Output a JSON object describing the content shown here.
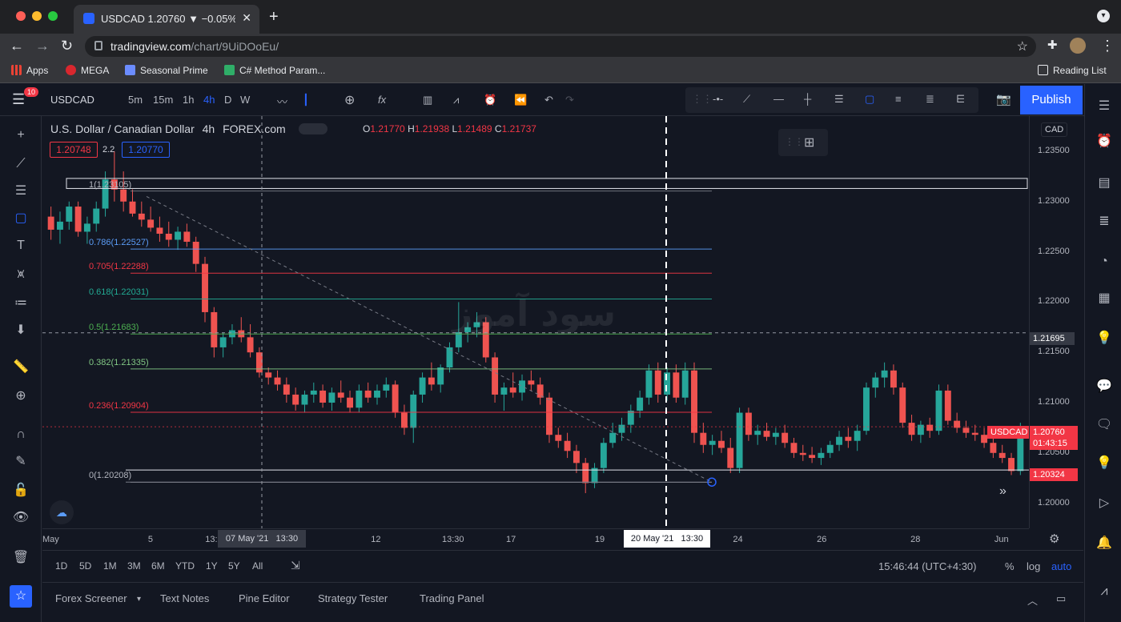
{
  "browser": {
    "tab_title": "USDCAD 1.20760 ▼ −0.05% pi",
    "url_host": "tradingview.com",
    "url_path": "/chart/9UiDOoEu/",
    "bookmarks": [
      "Apps",
      "MEGA",
      "Seasonal Prime",
      "C# Method Param..."
    ],
    "reading_list": "Reading List"
  },
  "toolbar": {
    "symbol": "USDCAD",
    "intervals": [
      "5m",
      "15m",
      "1h",
      "4h",
      "D",
      "W"
    ],
    "active_interval": "4h",
    "publish_label": "Publish",
    "notification_count": "10"
  },
  "legend": {
    "title": "U.S. Dollar / Canadian Dollar",
    "interval": "4h",
    "exchange": "FOREX.com",
    "o_label": "O",
    "o": "1.21770",
    "h_label": "H",
    "h": "1.21938",
    "l_label": "L",
    "l": "1.21489",
    "c_label": "C",
    "c": "1.21737",
    "bid": "1.20748",
    "spread": "2.2",
    "ask": "1.20770"
  },
  "watermark": "سود آموز",
  "fib_levels": [
    {
      "label": "1(1.23105)",
      "price": 1.23105,
      "color": "#787b86"
    },
    {
      "label": "0.786(1.22527)",
      "price": 1.22527,
      "color": "#5b9cf6"
    },
    {
      "label": "0.705(1.22288)",
      "price": 1.22288,
      "color": "#f23645"
    },
    {
      "label": "0.618(1.22031)",
      "price": 1.22031,
      "color": "#22ab94"
    },
    {
      "label": "0.5(1.21683)",
      "price": 1.21683,
      "color": "#4caf50"
    },
    {
      "label": "0.382(1.21335)",
      "price": 1.21335,
      "color": "#81c784"
    },
    {
      "label": "0.236(1.20904)",
      "price": 1.20904,
      "color": "#f23645"
    },
    {
      "label": "0(1.20208)",
      "price": 1.20208,
      "color": "#787b86"
    }
  ],
  "price_axis": {
    "currency": "CAD",
    "ticks": [
      "1.23500",
      "1.23000",
      "1.22500",
      "1.22000",
      "1.21500",
      "1.21000",
      "1.20500",
      "1.20000"
    ],
    "tick_values": [
      1.235,
      1.23,
      1.225,
      1.22,
      1.215,
      1.21,
      1.205,
      1.2
    ],
    "crosshair_price": "1.21695",
    "last_symbol": "USDCAD",
    "last_price": "1.20760",
    "countdown": "01:43:15",
    "low_tag": "1.20324"
  },
  "time_axis": {
    "ticks": [
      {
        "label": "May",
        "x": 0.0
      },
      {
        "label": "5",
        "x": 0.107
      },
      {
        "label": "13:",
        "x": 0.165
      },
      {
        "label": "12",
        "x": 0.333
      },
      {
        "label": "13:30",
        "x": 0.405
      },
      {
        "label": "17",
        "x": 0.47
      },
      {
        "label": "19",
        "x": 0.56
      },
      {
        "label": "24",
        "x": 0.7
      },
      {
        "label": "26",
        "x": 0.785
      },
      {
        "label": "28",
        "x": 0.88
      },
      {
        "label": "Jun",
        "x": 0.965
      }
    ],
    "crosshair_date": "07 May '21   13:30",
    "marker_date": "20 May '21   13:30"
  },
  "ranges": [
    "1D",
    "5D",
    "1M",
    "3M",
    "6M",
    "YTD",
    "1Y",
    "5Y",
    "All"
  ],
  "clock": "15:46:44 (UTC+4:30)",
  "axis_modes": [
    "%",
    "log",
    "auto"
  ],
  "bottom_tabs": [
    "Forex Screener",
    "Text Notes",
    "Pine Editor",
    "Strategy Tester",
    "Trading Panel"
  ],
  "colors": {
    "up": "#26a69a",
    "down": "#ef5350",
    "accent": "#2962ff",
    "bg": "#131722"
  },
  "chart_data": {
    "type": "candlestick",
    "symbol": "USDCAD",
    "ylim": [
      1.1975,
      1.2385
    ],
    "candles": [
      [
        1.2285,
        1.2295,
        1.2262,
        1.2272
      ],
      [
        1.2272,
        1.229,
        1.2258,
        1.228
      ],
      [
        1.228,
        1.23,
        1.2272,
        1.2295
      ],
      [
        1.2295,
        1.23,
        1.2265,
        1.227
      ],
      [
        1.227,
        1.2285,
        1.2258,
        1.2278
      ],
      [
        1.2278,
        1.23,
        1.227,
        1.2293
      ],
      [
        1.2293,
        1.233,
        1.2285,
        1.2322
      ],
      [
        1.2322,
        1.235,
        1.23,
        1.2312
      ],
      [
        1.2312,
        1.233,
        1.229,
        1.23
      ],
      [
        1.23,
        1.2312,
        1.2285,
        1.2288
      ],
      [
        1.2288,
        1.23,
        1.2275,
        1.2282
      ],
      [
        1.2282,
        1.2295,
        1.227,
        1.2274
      ],
      [
        1.2274,
        1.2285,
        1.226,
        1.2268
      ],
      [
        1.2268,
        1.228,
        1.2255,
        1.2262
      ],
      [
        1.2262,
        1.2275,
        1.2252,
        1.227
      ],
      [
        1.227,
        1.2278,
        1.2255,
        1.226
      ],
      [
        1.226,
        1.2265,
        1.223,
        1.2238
      ],
      [
        1.2238,
        1.2245,
        1.218,
        1.219
      ],
      [
        1.219,
        1.2195,
        1.2145,
        1.2155
      ],
      [
        1.2155,
        1.217,
        1.2145,
        1.2165
      ],
      [
        1.2165,
        1.2178,
        1.2158,
        1.2172
      ],
      [
        1.2172,
        1.2185,
        1.216,
        1.2165
      ],
      [
        1.2165,
        1.2178,
        1.2145,
        1.215
      ],
      [
        1.215,
        1.2155,
        1.2125,
        1.213
      ],
      [
        1.213,
        1.2135,
        1.2118,
        1.2125
      ],
      [
        1.2125,
        1.2132,
        1.2112,
        1.2118
      ],
      [
        1.2118,
        1.2125,
        1.21,
        1.2108
      ],
      [
        1.2108,
        1.2115,
        1.2092,
        1.2098
      ],
      [
        1.2098,
        1.2112,
        1.209,
        1.2108
      ],
      [
        1.2108,
        1.212,
        1.21,
        1.2112
      ],
      [
        1.2112,
        1.2118,
        1.2095,
        1.21
      ],
      [
        1.21,
        1.2115,
        1.2092,
        1.211
      ],
      [
        1.211,
        1.2122,
        1.21,
        1.2105
      ],
      [
        1.2105,
        1.2112,
        1.209,
        1.2095
      ],
      [
        1.2095,
        1.2118,
        1.209,
        1.2112
      ],
      [
        1.2112,
        1.212,
        1.21,
        1.2105
      ],
      [
        1.2105,
        1.2118,
        1.2098,
        1.2112
      ],
      [
        1.2112,
        1.2125,
        1.2105,
        1.2118
      ],
      [
        1.2118,
        1.2122,
        1.2085,
        1.209
      ],
      [
        1.209,
        1.2098,
        1.2068,
        1.2075
      ],
      [
        1.2075,
        1.2112,
        1.206,
        1.2108
      ],
      [
        1.2108,
        1.213,
        1.21,
        1.2125
      ],
      [
        1.2125,
        1.214,
        1.2112,
        1.2118
      ],
      [
        1.2118,
        1.2138,
        1.211,
        1.2135
      ],
      [
        1.2135,
        1.216,
        1.213,
        1.2155
      ],
      [
        1.2155,
        1.22,
        1.215,
        1.217
      ],
      [
        1.217,
        1.218,
        1.216,
        1.2175
      ],
      [
        1.2175,
        1.219,
        1.2165,
        1.218
      ],
      [
        1.218,
        1.2185,
        1.214,
        1.2145
      ],
      [
        1.2145,
        1.215,
        1.21,
        1.2108
      ],
      [
        1.2108,
        1.212,
        1.2092,
        1.2115
      ],
      [
        1.2115,
        1.213,
        1.2105,
        1.211
      ],
      [
        1.211,
        1.2128,
        1.2102,
        1.2122
      ],
      [
        1.2122,
        1.2132,
        1.2112,
        1.2118
      ],
      [
        1.2118,
        1.2125,
        1.2098,
        1.2105
      ],
      [
        1.2105,
        1.211,
        1.206,
        1.2068
      ],
      [
        1.2068,
        1.2075,
        1.2055,
        1.2062
      ],
      [
        1.2062,
        1.207,
        1.2045,
        1.2052
      ],
      [
        1.2052,
        1.2058,
        1.203,
        1.204
      ],
      [
        1.204,
        1.2045,
        1.201,
        1.202
      ],
      [
        1.202,
        1.204,
        1.2015,
        1.2035
      ],
      [
        1.2035,
        1.2065,
        1.203,
        1.206
      ],
      [
        1.206,
        1.208,
        1.2055,
        1.207
      ],
      [
        1.207,
        1.2085,
        1.2062,
        1.2078
      ],
      [
        1.2078,
        1.2098,
        1.207,
        1.2092
      ],
      [
        1.2092,
        1.2112,
        1.2085,
        1.2105
      ],
      [
        1.2105,
        1.2138,
        1.2098,
        1.2132
      ],
      [
        1.2132,
        1.214,
        1.21,
        1.2108
      ],
      [
        1.2108,
        1.2135,
        1.2102,
        1.213
      ],
      [
        1.213,
        1.2138,
        1.21,
        1.2105
      ],
      [
        1.2105,
        1.214,
        1.2098,
        1.2132
      ],
      [
        1.2132,
        1.214,
        1.206,
        1.207
      ],
      [
        1.207,
        1.208,
        1.205,
        1.2058
      ],
      [
        1.2058,
        1.2068,
        1.2048,
        1.2062
      ],
      [
        1.2062,
        1.2072,
        1.205,
        1.2055
      ],
      [
        1.2055,
        1.2065,
        1.203,
        1.2035
      ],
      [
        1.2035,
        1.2095,
        1.203,
        1.209
      ],
      [
        1.209,
        1.2095,
        1.2062,
        1.2068
      ],
      [
        1.2068,
        1.2078,
        1.2058,
        1.2072
      ],
      [
        1.2072,
        1.208,
        1.2062,
        1.2066
      ],
      [
        1.2066,
        1.2075,
        1.2058,
        1.207
      ],
      [
        1.207,
        1.2078,
        1.2055,
        1.206
      ],
      [
        1.206,
        1.2065,
        1.2045,
        1.205
      ],
      [
        1.205,
        1.2058,
        1.2042,
        1.2048
      ],
      [
        1.2048,
        1.2056,
        1.204,
        1.2045
      ],
      [
        1.2045,
        1.2055,
        1.2038,
        1.205
      ],
      [
        1.205,
        1.2062,
        1.2045,
        1.2058
      ],
      [
        1.2058,
        1.2072,
        1.2052,
        1.2066
      ],
      [
        1.2066,
        1.2075,
        1.2055,
        1.2062
      ],
      [
        1.2062,
        1.2078,
        1.2052,
        1.2072
      ],
      [
        1.2072,
        1.212,
        1.2068,
        1.2115
      ],
      [
        1.2115,
        1.213,
        1.2105,
        1.2125
      ],
      [
        1.2125,
        1.214,
        1.2115,
        1.2132
      ],
      [
        1.2132,
        1.2138,
        1.2108,
        1.2115
      ],
      [
        1.2115,
        1.212,
        1.2075,
        1.208
      ],
      [
        1.208,
        1.2088,
        1.2062,
        1.2068
      ],
      [
        1.2068,
        1.2082,
        1.206,
        1.2078
      ],
      [
        1.2078,
        1.2085,
        1.2065,
        1.2072
      ],
      [
        1.2072,
        1.2118,
        1.2068,
        1.2112
      ],
      [
        1.2112,
        1.2118,
        1.2078,
        1.2082
      ],
      [
        1.2082,
        1.209,
        1.207,
        1.2075
      ],
      [
        1.2075,
        1.2082,
        1.2065,
        1.207
      ],
      [
        1.207,
        1.2078,
        1.2062,
        1.2068
      ],
      [
        1.2068,
        1.2075,
        1.2055,
        1.206
      ],
      [
        1.206,
        1.2068,
        1.2045,
        1.205
      ],
      [
        1.205,
        1.2058,
        1.204,
        1.2045
      ],
      [
        1.2045,
        1.205,
        1.2028,
        1.2032
      ],
      [
        1.2032,
        1.208,
        1.2028,
        1.2076
      ]
    ]
  }
}
